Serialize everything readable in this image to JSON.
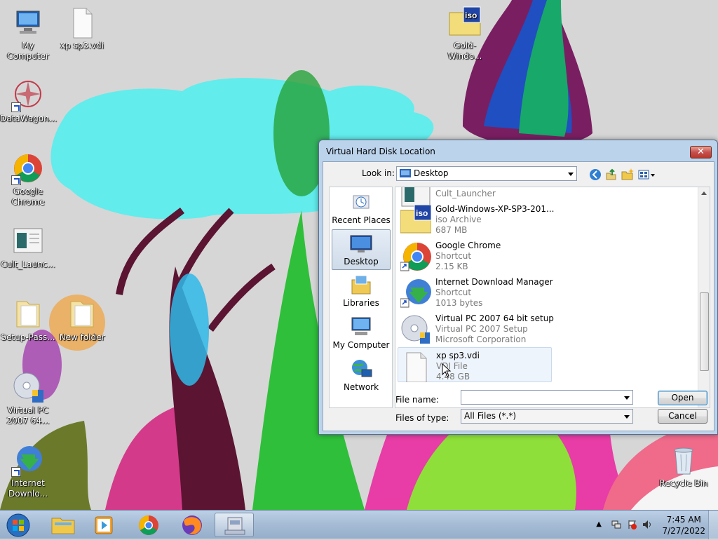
{
  "desktop": {
    "icons": [
      {
        "label": "My Computer",
        "icon": "computer-icon"
      },
      {
        "label": "xp sp3.vdi",
        "icon": "file-icon"
      },
      {
        "label": "Gold-Windo...",
        "icon": "iso-archive-icon"
      },
      {
        "label": "DataWagon...",
        "icon": "datawagon-icon"
      },
      {
        "label": "Google Chrome",
        "icon": "chrome-icon"
      },
      {
        "label": "Cult_Launc...",
        "icon": "launcher-icon"
      },
      {
        "label": "Setup-Pass...",
        "icon": "folder-icon"
      },
      {
        "label": "New folder",
        "icon": "folder-icon"
      },
      {
        "label": "Virtual PC 2007 64...",
        "icon": "setup-disc-icon"
      },
      {
        "label": "Internet Downlo...",
        "icon": "idm-icon"
      },
      {
        "label": "Recycle Bin",
        "icon": "recycle-bin-icon"
      }
    ]
  },
  "dialog": {
    "title": "Virtual Hard Disk Location",
    "close_label": "✕",
    "look_in_label": "Look in:",
    "look_in_value": "Desktop",
    "places": [
      {
        "label": "Recent Places",
        "selected": false
      },
      {
        "label": "Desktop",
        "selected": true
      },
      {
        "label": "Libraries",
        "selected": false
      },
      {
        "label": "My Computer",
        "selected": false
      },
      {
        "label": "Network",
        "selected": false
      }
    ],
    "files": [
      {
        "name": "Cult_Launcher",
        "line1": "",
        "line2": ""
      },
      {
        "name": "Gold-Windows-XP-SP3-201...",
        "line1": "iso Archive",
        "line2": "687 MB"
      },
      {
        "name": "Google Chrome",
        "line1": "Shortcut",
        "line2": "2.15 KB"
      },
      {
        "name": "Internet Download Manager",
        "line1": "Shortcut",
        "line2": "1013 bytes"
      },
      {
        "name": "Virtual PC 2007 64 bit setup",
        "line1": "Virtual PC 2007 Setup",
        "line2": "Microsoft Corporation"
      },
      {
        "name": "xp sp3.vdi",
        "line1": "VDI File",
        "line2": "4.48 GB"
      }
    ],
    "file_name_label": "File name:",
    "file_name_value": "",
    "file_type_label": "Files of type:",
    "file_type_value": "All Files (*.*)",
    "open_label": "Open",
    "cancel_label": "Cancel"
  },
  "taskbar": {
    "time": "7:45 AM",
    "date": "7/27/2022"
  },
  "colors": {
    "title_bar": "#bcd3ec",
    "close_red": "#c75050",
    "selection": "#cfdbe9",
    "taskbar": "#a7bdd6"
  }
}
